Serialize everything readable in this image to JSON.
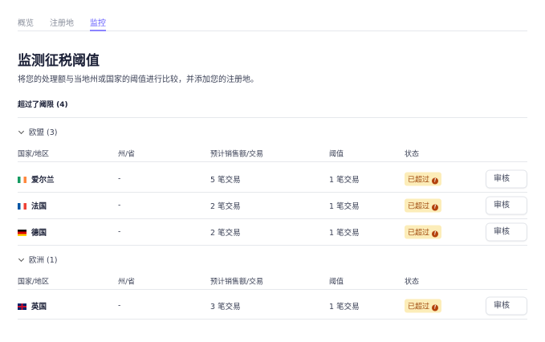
{
  "tabs": [
    {
      "label": "概览"
    },
    {
      "label": "注册地"
    },
    {
      "label": "监控",
      "active": true
    }
  ],
  "title": "监测征税阈值",
  "description": "将您的处理额与当地州或国家的阈值进行比较，并添加您的注册地。",
  "section_title": "超过了阈限 (4)",
  "columns": [
    "国家/地区",
    "州/省",
    "预计销售额/交易",
    "阈值",
    "状态"
  ],
  "groups": [
    {
      "label": "欧盟 (3)",
      "rows": [
        {
          "flag": "ireland-flag",
          "country": "爱尔兰",
          "state": "-",
          "sales": "5 笔交易",
          "threshold": "1 笔交易",
          "status": "已超过",
          "action": "审核"
        },
        {
          "flag": "france-flag",
          "country": "法国",
          "state": "-",
          "sales": "2 笔交易",
          "threshold": "1 笔交易",
          "status": "已超过",
          "action": "审核"
        },
        {
          "flag": "germany-flag",
          "country": "德国",
          "state": "-",
          "sales": "2 笔交易",
          "threshold": "1 笔交易",
          "status": "已超过",
          "action": "审核"
        }
      ]
    },
    {
      "label": "欧洲 (1)",
      "rows": [
        {
          "flag": "uk-flag",
          "country": "英国",
          "state": "-",
          "sales": "3 笔交易",
          "threshold": "1 笔交易",
          "status": "已超过",
          "action": "审核"
        }
      ]
    }
  ],
  "colors": {
    "accent": "#635bff",
    "badge_bg": "#fcedb9",
    "badge_text": "#a04a0e"
  }
}
